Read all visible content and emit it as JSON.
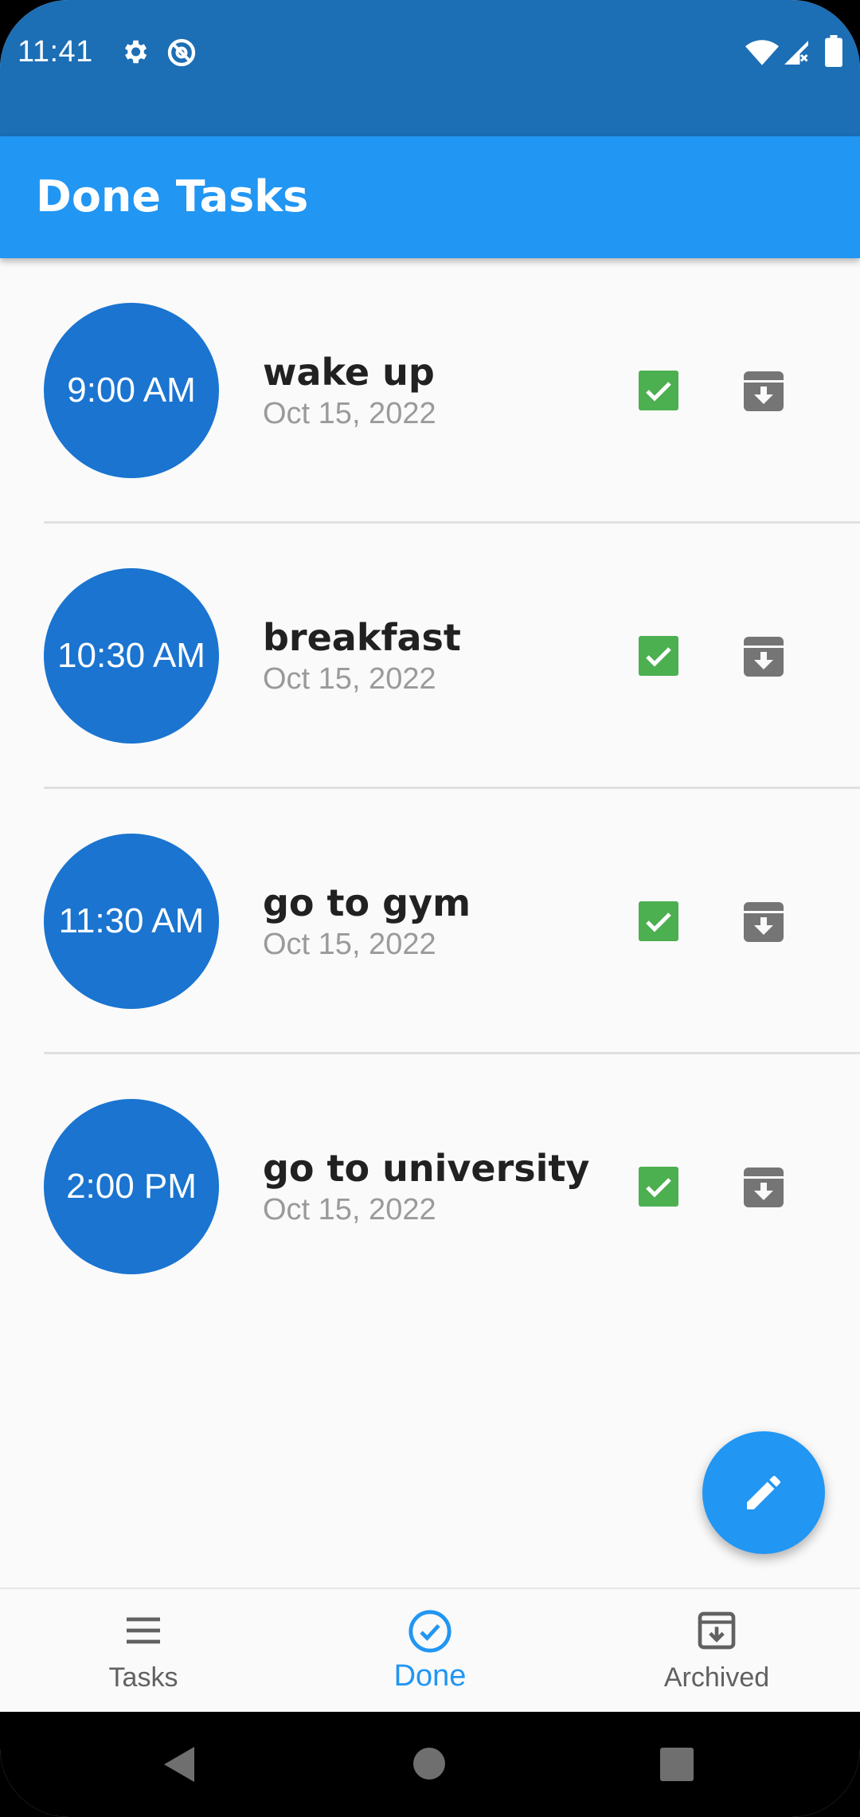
{
  "status_bar": {
    "time": "11:41",
    "icons": [
      "settings-icon",
      "at-sign-icon",
      "wifi-icon",
      "signal-icon",
      "battery-icon"
    ]
  },
  "app_bar": {
    "title": "Done Tasks"
  },
  "tasks": [
    {
      "time": "9:00 AM",
      "title": "wake up",
      "date": "Oct 15, 2022",
      "done": true
    },
    {
      "time": "10:30 AM",
      "title": "breakfast",
      "date": "Oct 15, 2022",
      "done": true
    },
    {
      "time": "11:30 AM",
      "title": "go to gym",
      "date": "Oct 15, 2022",
      "done": true
    },
    {
      "time": "2:00 PM",
      "title": "go to university",
      "date": "Oct 15, 2022",
      "done": true
    }
  ],
  "fab": {
    "icon": "edit-pencil-icon"
  },
  "bottom_nav": {
    "items": [
      {
        "label": "Tasks",
        "icon": "menu-lines-icon",
        "active": false
      },
      {
        "label": "Done",
        "icon": "check-circle-icon",
        "active": true
      },
      {
        "label": "Archived",
        "icon": "archive-icon",
        "active": false
      }
    ]
  },
  "colors": {
    "status_bar": "#1c6eb5",
    "app_bar": "#2196f3",
    "task_circle": "#1a74d0",
    "check_green": "#4caf50",
    "archive_grey": "#757575",
    "nav_active": "#2196f3"
  }
}
